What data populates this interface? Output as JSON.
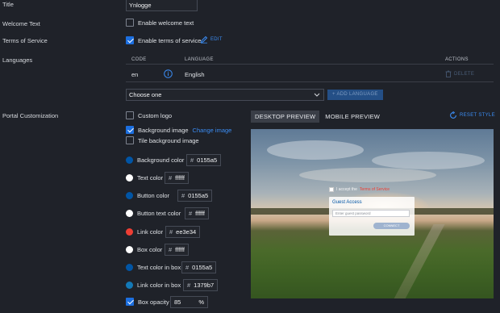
{
  "title_label": "Title",
  "title_value": "Ynlogge",
  "welcome_label": "Welcome Text",
  "welcome_checkbox": "Enable welcome text",
  "tos_label": "Terms of Service",
  "tos_checkbox": "Enable terms of service",
  "tos_edit": "EDIT",
  "languages_label": "Languages",
  "lang_table": {
    "headers": [
      "CODE",
      "LANGUAGE",
      "ACTIONS"
    ],
    "rows": [
      {
        "code": "en",
        "language": "English",
        "action": "DELETE"
      }
    ]
  },
  "lang_select": "Choose one",
  "add_language": "+ ADD LANGUAGE",
  "portal_label": "Portal Customization",
  "custom_logo": "Custom logo",
  "bg_image": "Background image",
  "change_image": "Change image",
  "tile_bg": "Tile background image",
  "colors": [
    {
      "label": "Background color",
      "value": "0155a5",
      "swatch": "#0155a5"
    },
    {
      "label": "Text color",
      "value": "ffffff",
      "swatch": "#ffffff"
    },
    {
      "label": "Button color",
      "value": "0155a5",
      "swatch": "#0155a5"
    },
    {
      "label": "Button text color",
      "value": "ffffff",
      "swatch": "#ffffff"
    },
    {
      "label": "Link color",
      "value": "ee3e34",
      "swatch": "#ee3e34"
    },
    {
      "label": "Box color",
      "value": "ffffff",
      "swatch": "#ffffff"
    },
    {
      "label": "Text color in box",
      "value": "0155a5",
      "swatch": "#0155a5"
    },
    {
      "label": "Link color in box",
      "value": "1379b7",
      "swatch": "#1379b7"
    }
  ],
  "hash": "#",
  "box_opacity_label": "Box opacity",
  "box_opacity_value": "85",
  "box_opacity_unit": "%",
  "tabs": {
    "desktop": "DESKTOP PREVIEW",
    "mobile": "MOBILE PREVIEW"
  },
  "reset_style": "RESET STYLE",
  "preview": {
    "terms_text": "I accept the",
    "terms_link": "Terms of Service",
    "box_title": "Guest Access",
    "input_placeholder": "Enter guest password",
    "connect": "CONNECT"
  }
}
